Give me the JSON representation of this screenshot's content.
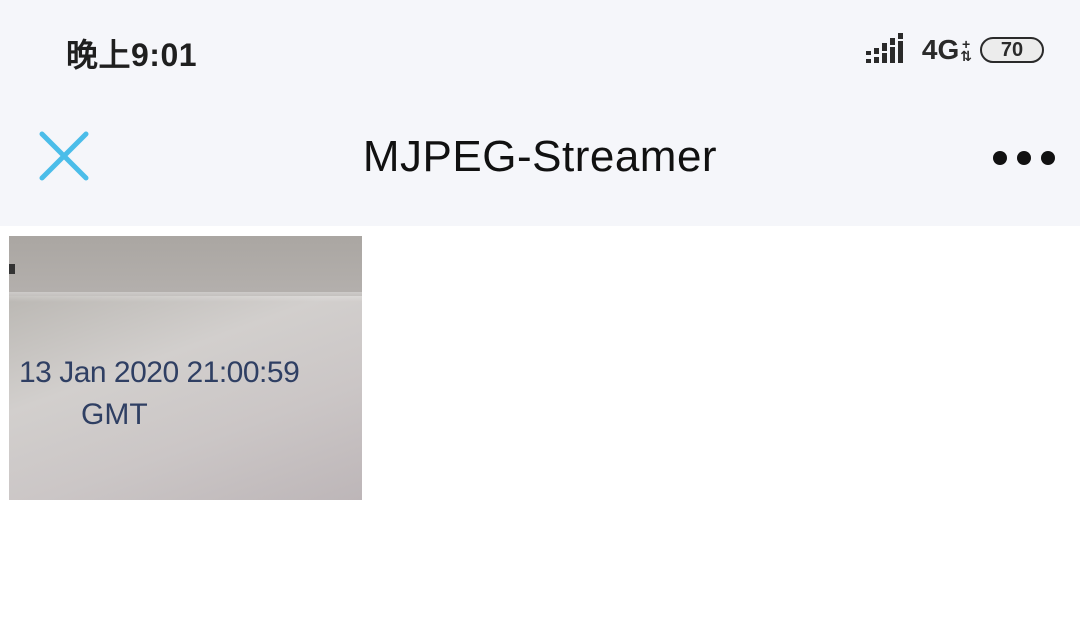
{
  "status_bar": {
    "time": "晚上9:01",
    "network": "4G",
    "battery": "70"
  },
  "nav": {
    "title": "MJPEG-Streamer",
    "close_icon": "close-icon",
    "more_icon": "more-icon",
    "accent_color": "#4bbde9"
  },
  "stream": {
    "timestamp": "13 Jan 2020 21:00:59",
    "timezone": "GMT"
  }
}
